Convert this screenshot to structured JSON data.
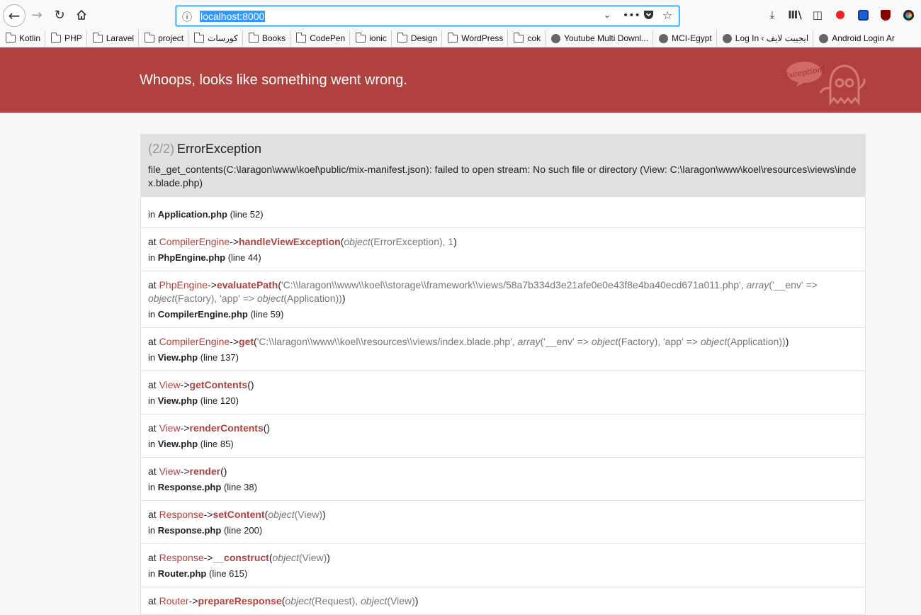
{
  "browser": {
    "url": "localhost:8000",
    "nav_icons": {
      "back": "back-arrow-icon",
      "forward": "forward-arrow-icon",
      "reload": "reload-icon",
      "home": "home-icon"
    },
    "url_actions": [
      "info-icon",
      "chevron-down-icon",
      "more-icon",
      "pocket-icon",
      "star-icon"
    ],
    "toolbar_icons": [
      "download-icon",
      "library-icon",
      "sidebar-icon",
      "extension-red-icon",
      "extension-blue-icon",
      "ublock-icon",
      "extension-color-icon"
    ],
    "bookmarks": [
      {
        "label": "Kotlin",
        "icon": "folder"
      },
      {
        "label": "PHP",
        "icon": "folder"
      },
      {
        "label": "Laravel",
        "icon": "folder"
      },
      {
        "label": "project",
        "icon": "folder"
      },
      {
        "label": "كورسات",
        "icon": "folder"
      },
      {
        "label": "Books",
        "icon": "folder"
      },
      {
        "label": "CodePen",
        "icon": "folder"
      },
      {
        "label": "ionic",
        "icon": "folder"
      },
      {
        "label": "Design",
        "icon": "folder"
      },
      {
        "label": "WordPress",
        "icon": "folder"
      },
      {
        "label": "cok",
        "icon": "folder"
      },
      {
        "label": "Youtube Multi Downl...",
        "icon": "globe"
      },
      {
        "label": "MCI-Egypt",
        "icon": "globe"
      },
      {
        "label": "Log In ‹ ايجيبت لايف",
        "icon": "globe"
      },
      {
        "label": "Android Login Ar",
        "icon": "globe"
      }
    ]
  },
  "banner": {
    "title": "Whoops, looks like something went wrong.",
    "logo_text": "Exception!",
    "color": "#b0413e"
  },
  "exception": {
    "count": "(2/2)",
    "name": "ErrorException",
    "message": "file_get_contents(C:\\laragon\\www\\koel\\public/mix-manifest.json): failed to open stream: No such file or directory (View: C:\\laragon\\www\\koel\\resources\\views\\index.blade.php)"
  },
  "frames": [
    {
      "at": "",
      "class": "",
      "function": "",
      "args": "",
      "file": "Application.php",
      "line": "(line 52)"
    },
    {
      "at": "at",
      "class": "CompilerEngine",
      "function": "handleViewException",
      "args": "object(ErrorException), 1",
      "file": "PhpEngine.php",
      "line": "(line 44)"
    },
    {
      "at": "at",
      "class": "PhpEngine",
      "function": "evaluatePath",
      "args": "'C:\\\\laragon\\\\www\\\\koel\\\\storage\\\\framework\\\\views/58a7b334d3e21afe0e0e43f8e4ba40ecd671a011.php', array('__env' => object(Factory), 'app' => object(Application))",
      "file": "CompilerEngine.php",
      "line": "(line 59)"
    },
    {
      "at": "at",
      "class": "CompilerEngine",
      "function": "get",
      "args": "'C:\\\\laragon\\\\www\\\\koel\\\\resources\\\\views/index.blade.php', array('__env' => object(Factory), 'app' => object(Application))",
      "file": "View.php",
      "line": "(line 137)"
    },
    {
      "at": "at",
      "class": "View",
      "function": "getContents",
      "args": "",
      "file": "View.php",
      "line": "(line 120)"
    },
    {
      "at": "at",
      "class": "View",
      "function": "renderContents",
      "args": "",
      "file": "View.php",
      "line": "(line 85)"
    },
    {
      "at": "at",
      "class": "View",
      "function": "render",
      "args": "",
      "file": "Response.php",
      "line": "(line 38)"
    },
    {
      "at": "at",
      "class": "Response",
      "function": "setContent",
      "args": "object(View)",
      "file": "Response.php",
      "line": "(line 200)"
    },
    {
      "at": "at",
      "class": "Response",
      "function": "__construct",
      "args": "object(View)",
      "file": "Router.php",
      "line": "(line 615)"
    },
    {
      "at": "at",
      "class": "Router",
      "function": "prepareResponse",
      "args": "object(Request), object(View)",
      "file": "",
      "line": ""
    }
  ],
  "labels": {
    "in": "in",
    "arrow": "->"
  }
}
